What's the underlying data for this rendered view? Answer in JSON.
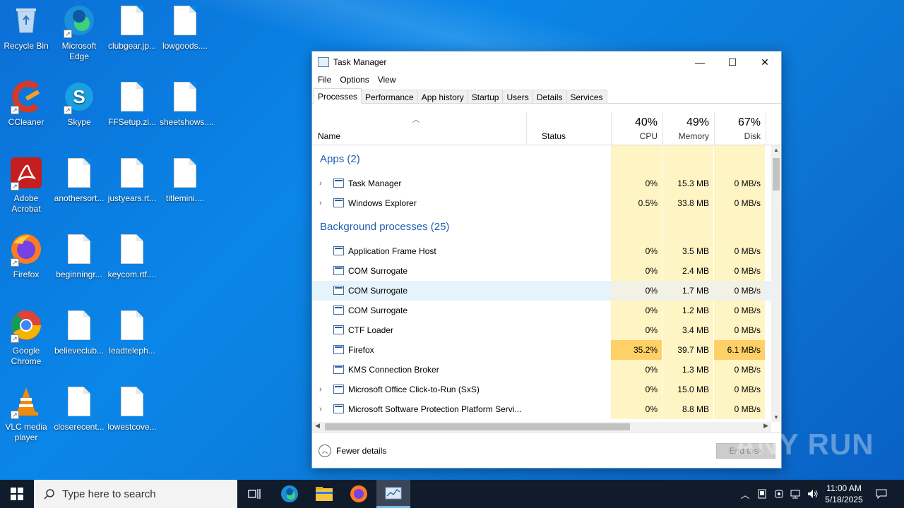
{
  "desktop": {
    "icons": [
      {
        "label": "Recycle Bin",
        "icon": "recycle-bin-icon"
      },
      {
        "label": "Microsoft Edge",
        "icon": "edge-icon"
      },
      {
        "label": "clubgear.jp...",
        "icon": "file-icon"
      },
      {
        "label": "lowgoods....",
        "icon": "file-icon"
      },
      {
        "label": "CCleaner",
        "icon": "ccleaner-icon"
      },
      {
        "label": "Skype",
        "icon": "skype-icon"
      },
      {
        "label": "FFSetup.zi...",
        "icon": "file-icon"
      },
      {
        "label": "sheetshows....",
        "icon": "file-icon"
      },
      {
        "label": "Adobe Acrobat",
        "icon": "acrobat-icon"
      },
      {
        "label": "anothersort...",
        "icon": "file-icon"
      },
      {
        "label": "justyears.rt...",
        "icon": "file-icon"
      },
      {
        "label": "titlemini....",
        "icon": "file-icon"
      },
      {
        "label": "Firefox",
        "icon": "firefox-icon"
      },
      {
        "label": "beginningr...",
        "icon": "file-icon"
      },
      {
        "label": "keycom.rtf....",
        "icon": "file-icon"
      },
      {
        "label": "Google Chrome",
        "icon": "chrome-icon"
      },
      {
        "label": "believeclub...",
        "icon": "file-icon"
      },
      {
        "label": "leadteleph...",
        "icon": "file-icon"
      },
      {
        "label": "VLC media player",
        "icon": "vlc-icon"
      },
      {
        "label": "closerecent...",
        "icon": "file-icon"
      },
      {
        "label": "lowestcove...",
        "icon": "file-icon"
      }
    ]
  },
  "task_manager": {
    "title": "Task Manager",
    "window_buttons": {
      "minimize": "—",
      "maximize": "☐",
      "close": "✕"
    },
    "menu": [
      "File",
      "Options",
      "View"
    ],
    "tabs": [
      "Processes",
      "Performance",
      "App history",
      "Startup",
      "Users",
      "Details",
      "Services"
    ],
    "active_tab": "Processes",
    "columns": {
      "name": "Name",
      "status": "Status",
      "cpu_pct": "40%",
      "cpu": "CPU",
      "memory_pct": "49%",
      "memory": "Memory",
      "disk_pct": "67%",
      "disk": "Disk"
    },
    "groups": {
      "apps": "Apps (2)",
      "background": "Background processes (25)"
    },
    "apps": [
      {
        "name": "Task Manager",
        "cpu": "0%",
        "memory": "15.3 MB",
        "disk": "0 MB/s",
        "expandable": true
      },
      {
        "name": "Windows Explorer",
        "cpu": "0.5%",
        "memory": "33.8 MB",
        "disk": "0 MB/s",
        "expandable": true
      }
    ],
    "background": [
      {
        "name": "Application Frame Host",
        "cpu": "0%",
        "memory": "3.5 MB",
        "disk": "0 MB/s"
      },
      {
        "name": "COM Surrogate",
        "cpu": "0%",
        "memory": "2.4 MB",
        "disk": "0 MB/s"
      },
      {
        "name": "COM Surrogate",
        "cpu": "0%",
        "memory": "1.7 MB",
        "disk": "0 MB/s",
        "selected": true
      },
      {
        "name": "COM Surrogate",
        "cpu": "0%",
        "memory": "1.2 MB",
        "disk": "0 MB/s"
      },
      {
        "name": "CTF Loader",
        "cpu": "0%",
        "memory": "3.4 MB",
        "disk": "0 MB/s"
      },
      {
        "name": "Firefox",
        "cpu": "35.2%",
        "memory": "39.7 MB",
        "disk": "6.1 MB/s",
        "hot": true
      },
      {
        "name": "KMS Connection Broker",
        "cpu": "0%",
        "memory": "1.3 MB",
        "disk": "0 MB/s"
      },
      {
        "name": "Microsoft Office Click-to-Run (SxS)",
        "cpu": "0%",
        "memory": "15.0 MB",
        "disk": "0 MB/s",
        "expandable": true
      },
      {
        "name": "Microsoft Software Protection Platform Servi...",
        "cpu": "0%",
        "memory": "8.8 MB",
        "disk": "0 MB/s",
        "expandable": true
      }
    ],
    "footer": {
      "fewer_details": "Fewer details",
      "end_task": "End task"
    }
  },
  "taskbar": {
    "search_placeholder": "Type here to search",
    "time": "11:00 AM",
    "date": "5/18/2025"
  },
  "watermark": "ANY RUN",
  "colors": {
    "desktop": "#0a86e8",
    "heat": "#fff4c4",
    "heat_hot": "#ffd067",
    "selected": "#e5f3fb",
    "link_blue": "#1f5fb0"
  }
}
